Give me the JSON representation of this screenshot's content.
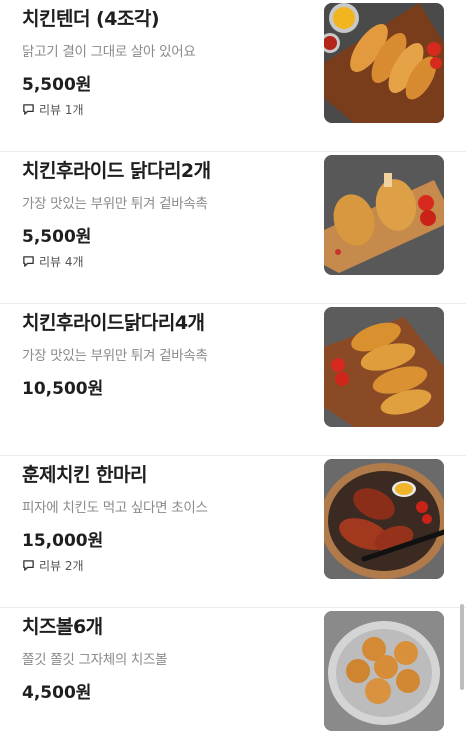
{
  "menu": {
    "items": [
      {
        "name": "치킨텐더 (4조각)",
        "description": "닭고기 결이 그대로 살아 있어요",
        "price": "5,500원",
        "review": "리뷰 1개",
        "thumbnail_icon": "chicken-tender-photo"
      },
      {
        "name": "치킨후라이드 닭다리2개",
        "description": "가장 맛있는 부위만 튀겨 겉바속촉",
        "price": "5,500원",
        "review": "리뷰 4개",
        "thumbnail_icon": "fried-drumsticks-photo"
      },
      {
        "name": "치킨후라이드닭다리4개",
        "description": "가장 맛있는 부위만 튀겨 겉바속촉",
        "price": "10,500원",
        "review": "",
        "thumbnail_icon": "fried-drumsticks-photo"
      },
      {
        "name": "훈제치킨 한마리",
        "description": "피자에 치킨도 먹고 싶다면 초이스",
        "price": "15,000원",
        "review": "리뷰 2개",
        "thumbnail_icon": "smoked-chicken-photo"
      },
      {
        "name": "치즈볼6개",
        "description": "쫄깃 쫄깃 그자체의 치즈볼",
        "price": "4,500원",
        "review": "",
        "thumbnail_icon": "cheese-balls-photo"
      }
    ]
  },
  "colors": {
    "name_text": "#1e1e1e",
    "description_text": "#8a8a8a",
    "divider": "#ececec"
  }
}
